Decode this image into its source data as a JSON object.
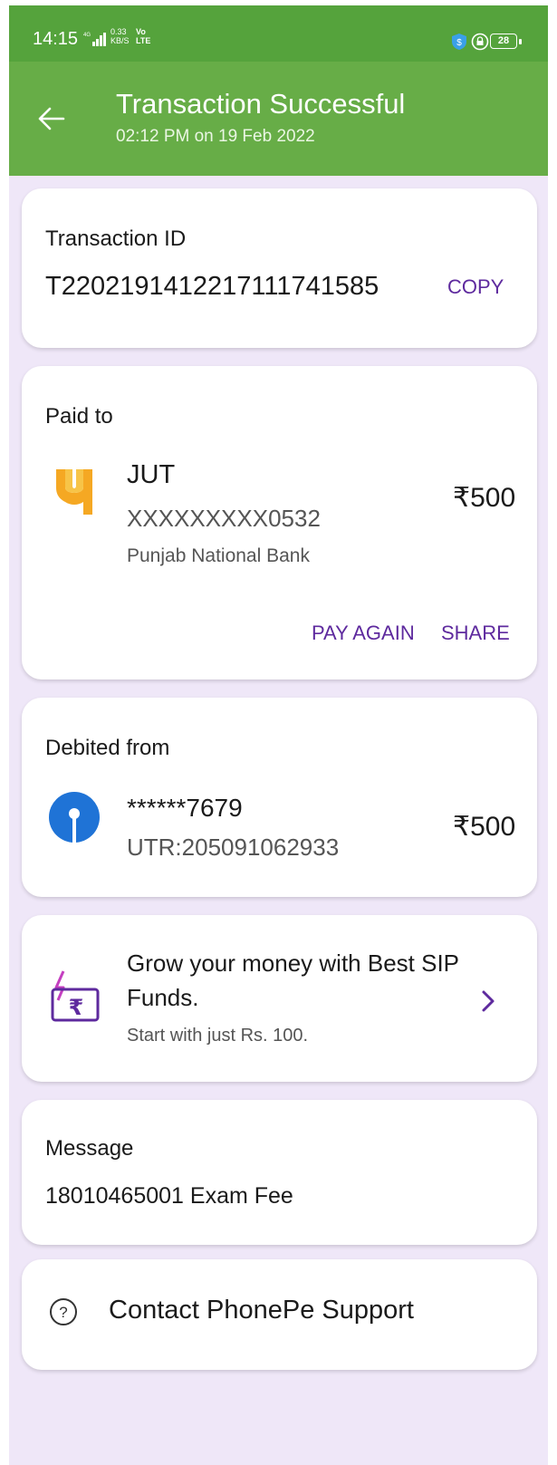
{
  "status_bar": {
    "time": "14:15",
    "network_speed": "0.33\nKB/S",
    "volte": "Vo\nLTE",
    "battery": "28"
  },
  "header": {
    "title": "Transaction Successful",
    "subtitle": "02:12 PM on 19 Feb 2022"
  },
  "transaction": {
    "label": "Transaction ID",
    "id": "T2202191412217111741585",
    "copy_label": "COPY"
  },
  "paid_to": {
    "label": "Paid to",
    "name": "JUT",
    "account": "XXXXXXXXX0532",
    "bank": "Punjab National Bank",
    "amount": "₹500",
    "pay_again_label": "PAY AGAIN",
    "share_label": "SHARE"
  },
  "debited_from": {
    "label": "Debited from",
    "account": "******7679",
    "utr": "UTR:205091062933",
    "amount": "₹500"
  },
  "promo": {
    "line1": "Grow your money with Best SIP",
    "line2": "Funds.",
    "subtext": "Start with just Rs. 100."
  },
  "message": {
    "label": "Message",
    "text": "18010465001 Exam Fee"
  },
  "support": {
    "label": "Contact PhonePe Support"
  },
  "colors": {
    "header_green": "#67ad47",
    "accent_purple": "#5e2a9e",
    "background": "#efe7f8"
  }
}
